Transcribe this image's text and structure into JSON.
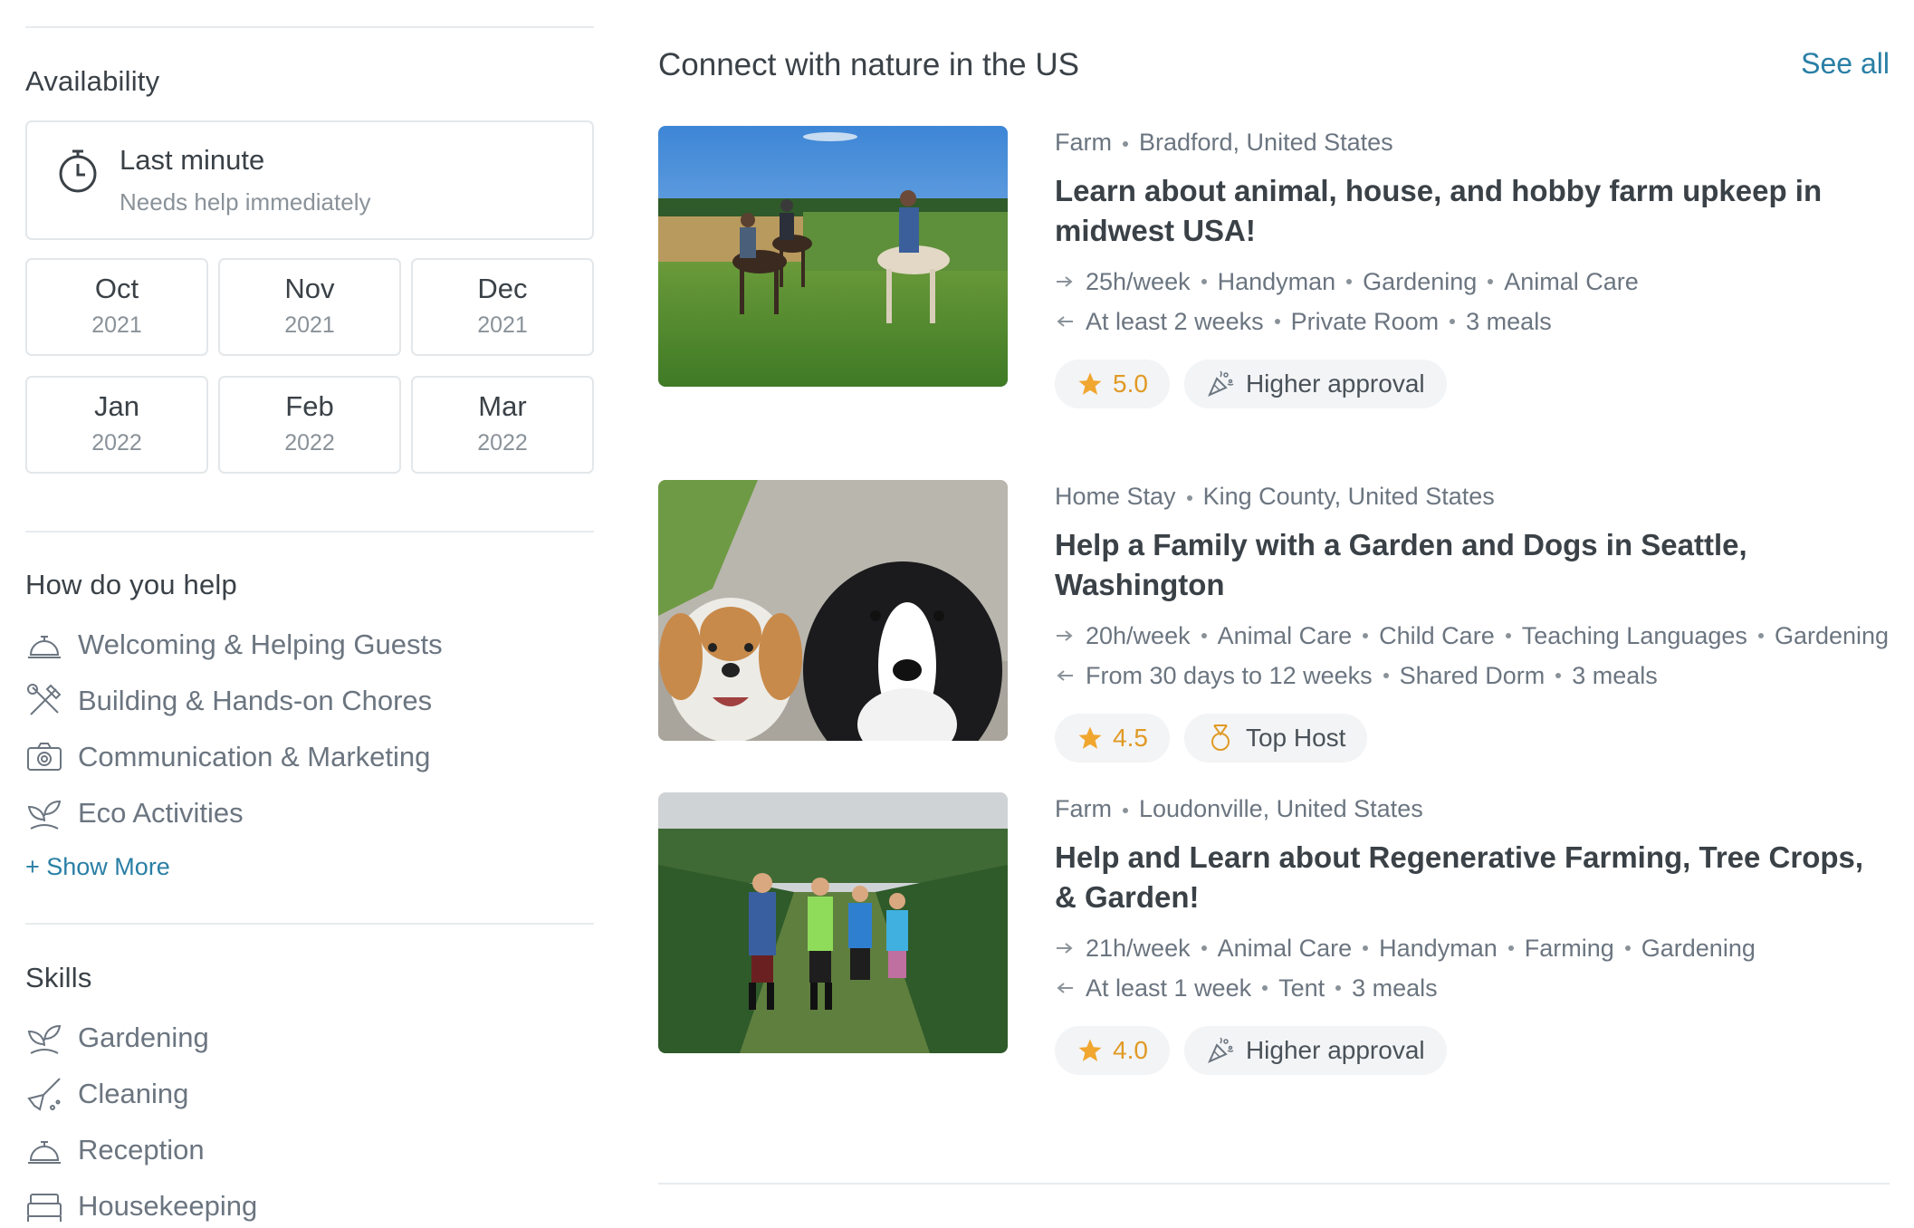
{
  "sidebar": {
    "availability": {
      "title": "Availability",
      "last_minute": {
        "title": "Last minute",
        "subtitle": "Needs help immediately",
        "icon": "stopwatch-icon"
      },
      "months": [
        {
          "name": "Oct",
          "year": "2021"
        },
        {
          "name": "Nov",
          "year": "2021"
        },
        {
          "name": "Dec",
          "year": "2021"
        },
        {
          "name": "Jan",
          "year": "2022"
        },
        {
          "name": "Feb",
          "year": "2022"
        },
        {
          "name": "Mar",
          "year": "2022"
        }
      ]
    },
    "help": {
      "title": "How do you help",
      "items": [
        {
          "label": "Welcoming & Helping Guests",
          "icon": "reception-bell-icon"
        },
        {
          "label": "Building & Hands-on Chores",
          "icon": "tools-icon"
        },
        {
          "label": "Communication & Marketing",
          "icon": "camera-icon"
        },
        {
          "label": "Eco Activities",
          "icon": "seedling-icon"
        }
      ],
      "show_more": "+ Show More"
    },
    "skills": {
      "title": "Skills",
      "items": [
        {
          "label": "Gardening",
          "icon": "seedling-icon"
        },
        {
          "label": "Cleaning",
          "icon": "broom-icon"
        },
        {
          "label": "Reception",
          "icon": "reception-bell-icon"
        },
        {
          "label": "Housekeeping",
          "icon": "bed-icon"
        }
      ]
    }
  },
  "main": {
    "title": "Connect with nature in the US",
    "see_all": "See all",
    "listings": [
      {
        "type": "Farm",
        "location": "Bradford, United States",
        "title": "Learn about animal, house, and hobby farm upkeep in midwest USA!",
        "give": [
          "25h/week",
          "Handyman",
          "Gardening",
          "Animal Care"
        ],
        "get": [
          "At least 2 weeks",
          "Private Room",
          "3 meals"
        ],
        "rating": "5.0",
        "badge": "Higher approval",
        "badge_icon": "confetti-icon",
        "image": "horses-riders-photo"
      },
      {
        "type": "Home Stay",
        "location": "King County, United States",
        "title": "Help a Family with a Garden and Dogs in Seattle, Washington",
        "give": [
          "20h/week",
          "Animal Care",
          "Child Care",
          "Teaching Languages",
          "Gardening"
        ],
        "get": [
          "From 30 days to 12 weeks",
          "Shared Dorm",
          "3 meals"
        ],
        "rating": "4.5",
        "badge": "Top Host",
        "badge_icon": "medal-icon",
        "image": "two-dogs-photo"
      },
      {
        "type": "Farm",
        "location": "Loudonville, United States",
        "title": "Help and Learn about Regenerative Farming, Tree Crops, & Garden!",
        "give": [
          "21h/week",
          "Animal Care",
          "Handyman",
          "Farming",
          "Gardening"
        ],
        "get": [
          "At least 1 week",
          "Tent",
          "3 meals"
        ],
        "rating": "4.0",
        "badge": "Higher approval",
        "badge_icon": "confetti-icon",
        "image": "children-orchard-photo"
      }
    ]
  },
  "colors": {
    "accent": "#2a7fa5",
    "star": "#f0a62f",
    "text": "#3a4147",
    "muted": "#6b7580"
  }
}
